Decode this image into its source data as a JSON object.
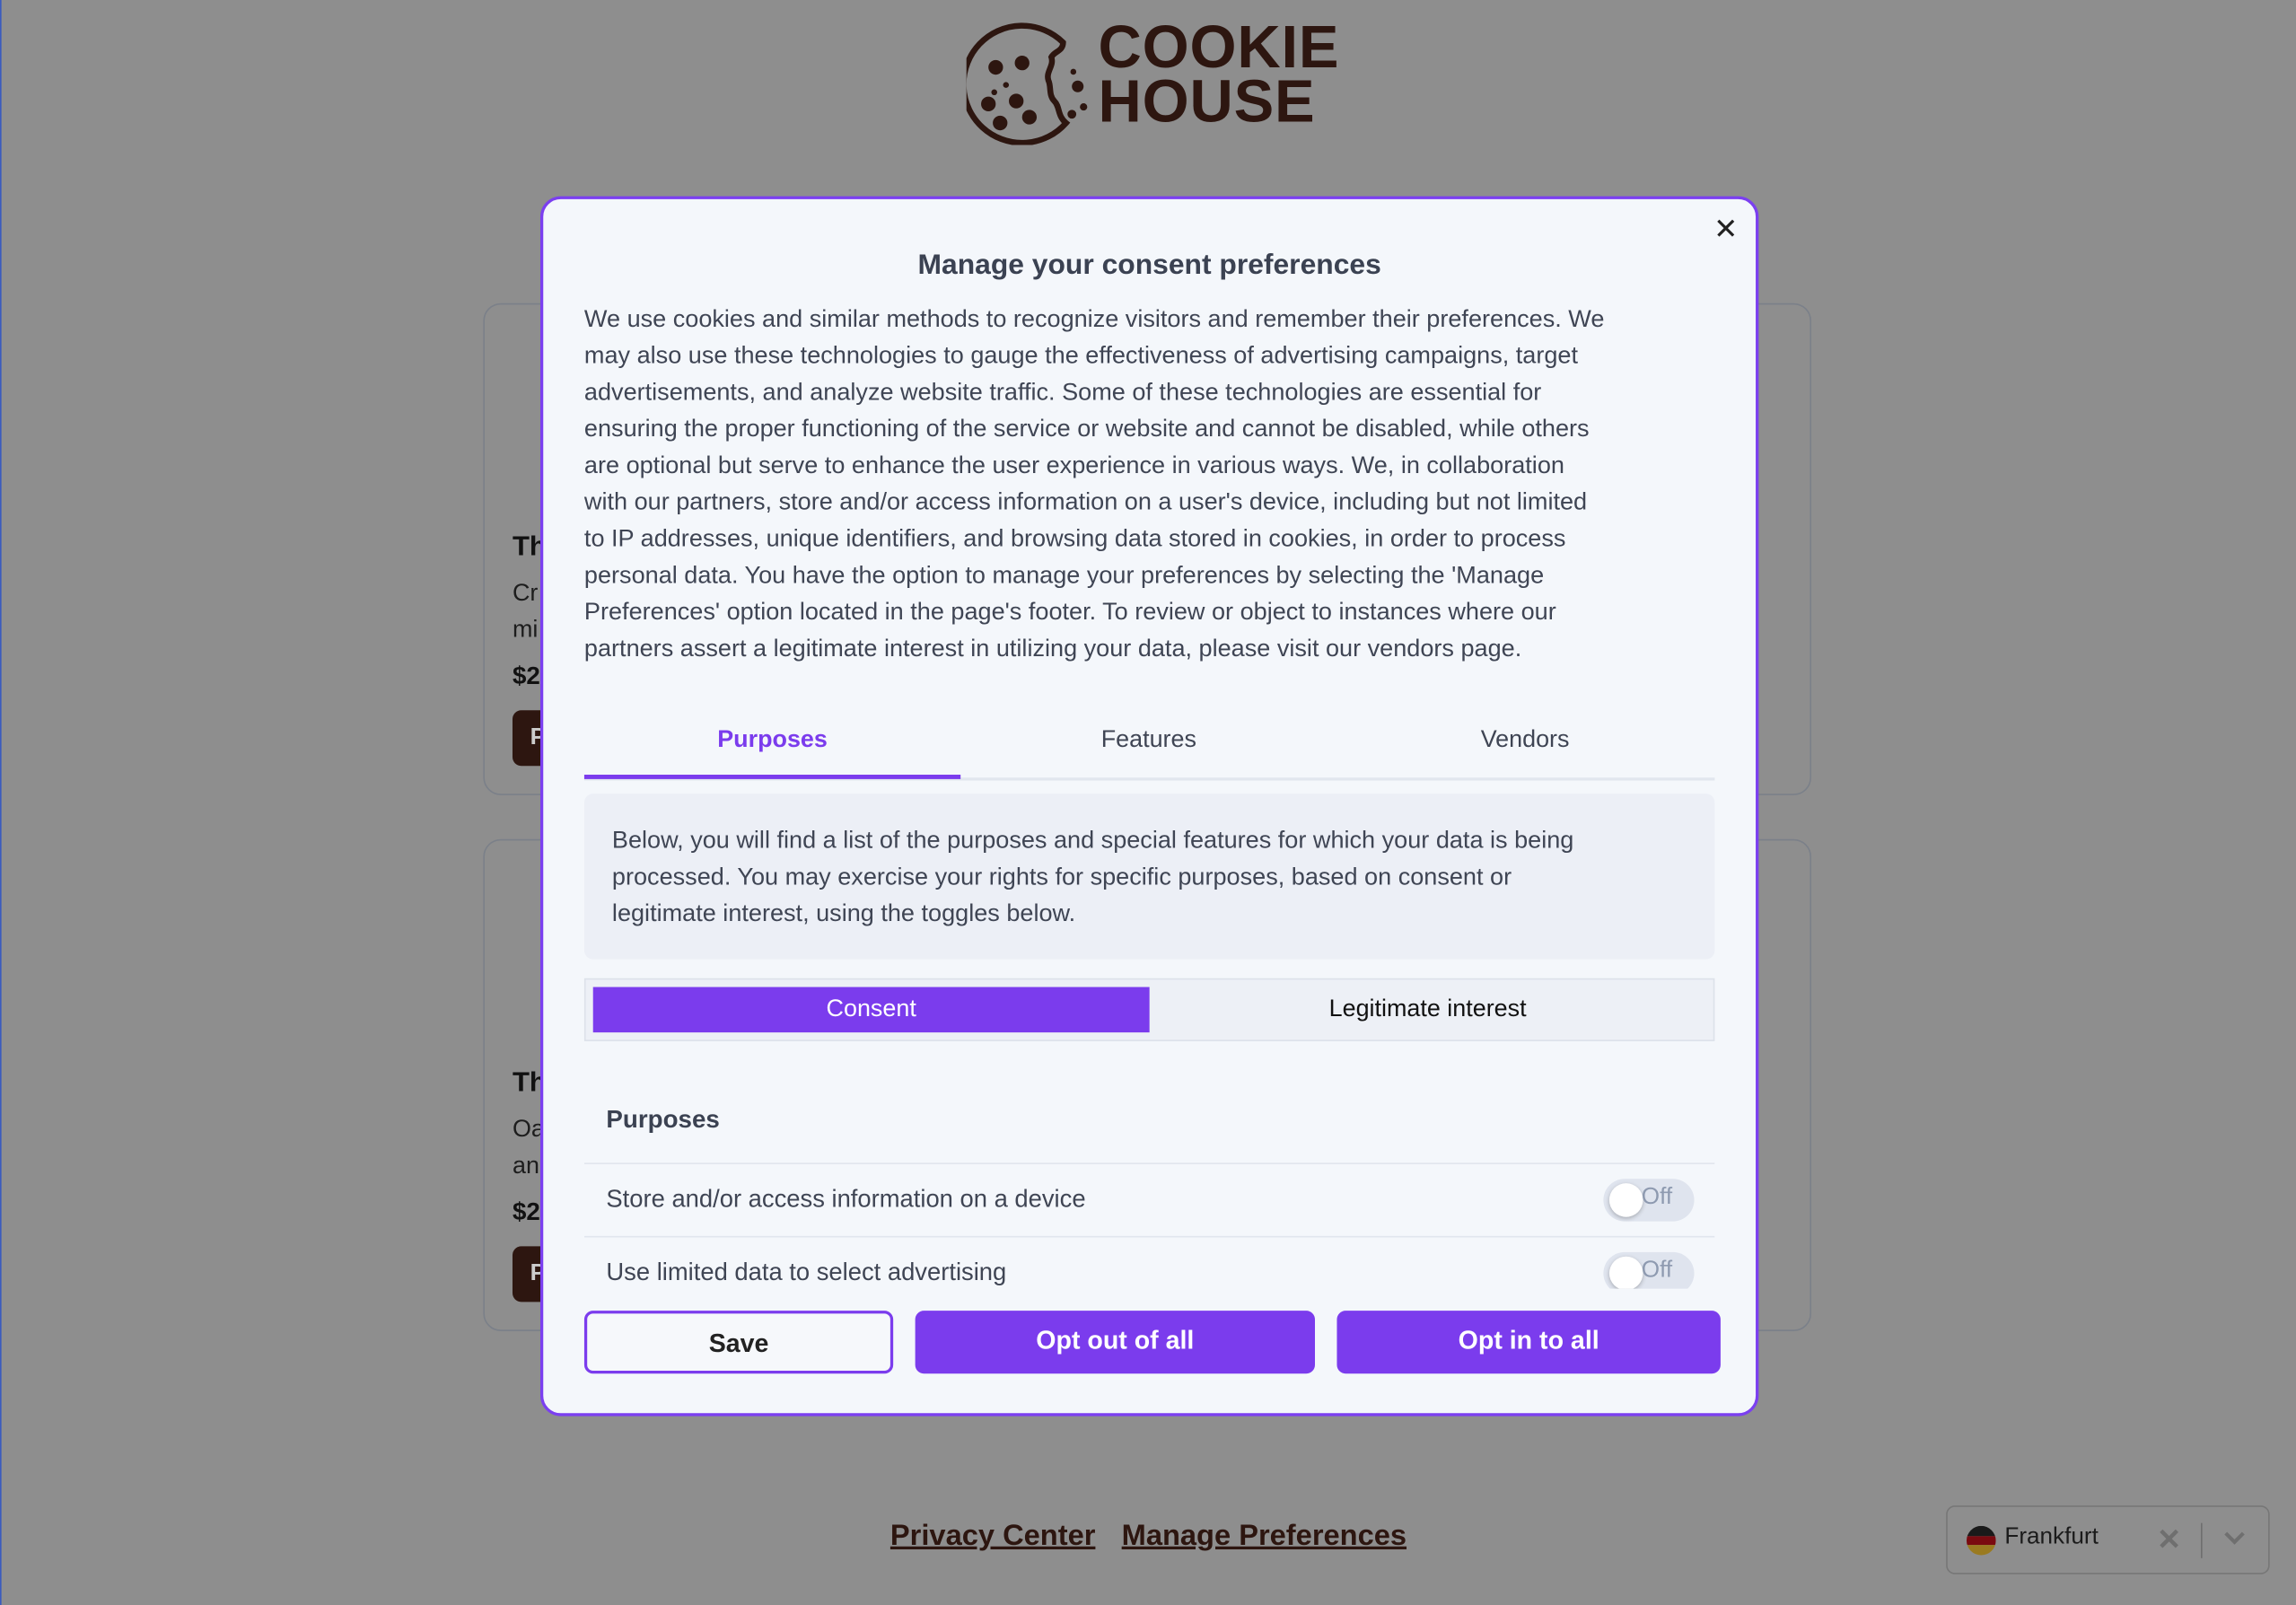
{
  "brand": {
    "line1": "COOKIE",
    "line2": "HOUSE",
    "color": "#2d1610"
  },
  "background_cards": [
    {
      "title": "Th",
      "desc_lines": [
        "Cr",
        "mi"
      ],
      "price": "$2",
      "button": "P"
    },
    {
      "title": "Th",
      "desc_lines": [
        "Oa",
        "an"
      ],
      "price": "$2",
      "button": "P"
    }
  ],
  "modal": {
    "close_icon": "close-icon",
    "title": "Manage your consent preferences",
    "intro_lines": [
      "We use cookies and similar methods to recognize visitors and remember their preferences. We",
      "may also use these technologies to gauge the effectiveness of advertising campaigns, target",
      "advertisements, and analyze website traffic. Some of these technologies are essential for",
      "ensuring the proper functioning of the service or website and cannot be disabled, while others",
      "are optional but serve to enhance the user experience in various ways. We, in collaboration",
      "with our partners, store and/or access information on a user's device, including but not limited",
      "to IP addresses, unique identifiers, and browsing data stored in cookies, in order to process",
      "personal data. You have the option to manage your preferences by selecting the 'Manage",
      "Preferences' option located in the page's footer. To review or object to instances where our",
      "partners assert a legitimate interest in utilizing your data, please visit our vendors page."
    ],
    "tabs": [
      {
        "label": "Purposes",
        "active": true
      },
      {
        "label": "Features",
        "active": false
      },
      {
        "label": "Vendors",
        "active": false
      }
    ],
    "info_lines": [
      "Below, you will find a list of the purposes and special features for which your data is being",
      "processed. You may exercise your rights for specific purposes, based on consent or",
      "legitimate interest, using the toggles below."
    ],
    "segments": {
      "consent": "Consent",
      "legitimate": "Legitimate interest",
      "selected": "Consent"
    },
    "purposes_header": "Purposes",
    "purposes": [
      {
        "label": "Store and/or access information on a device",
        "toggle": "Off"
      },
      {
        "label": "Use limited data to select advertising",
        "toggle": "Off"
      }
    ],
    "buttons": {
      "save": "Save",
      "opt_out": "Opt out of all",
      "opt_in": "Opt in to all"
    },
    "accent": "#7b3ced"
  },
  "footer": {
    "privacy_center": "Privacy Center",
    "manage_preferences": "Manage Preferences"
  },
  "location": {
    "value": "Frankfurt",
    "flag": "germany-flag-icon",
    "clear_icon": "close-icon",
    "dropdown_icon": "chevron-down-icon"
  }
}
